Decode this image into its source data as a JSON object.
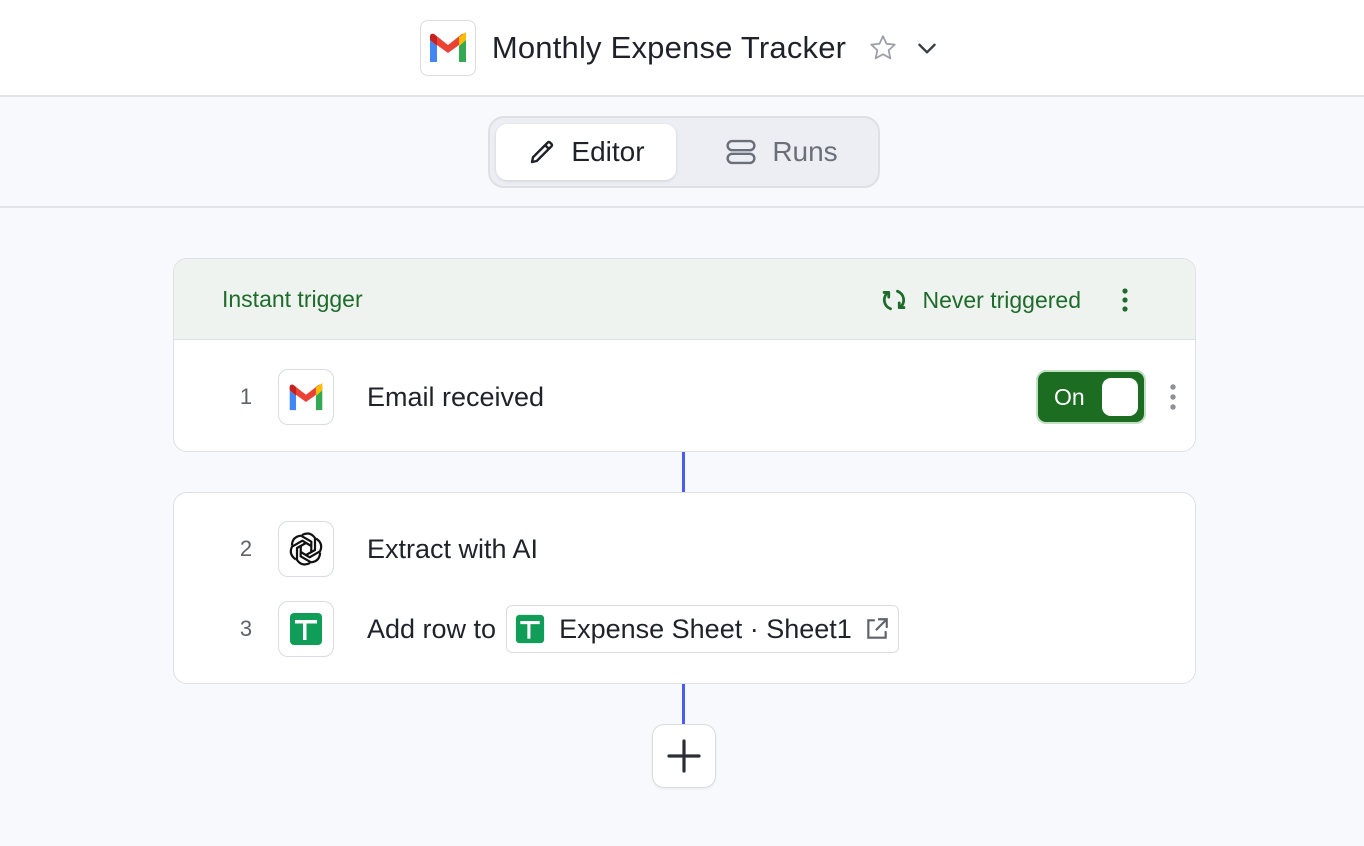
{
  "header": {
    "title": "Monthly Expense Tracker",
    "app_icon": "gmail-icon",
    "star_icon": "star-icon",
    "dropdown_icon": "chevron-down-icon"
  },
  "tabs": [
    {
      "label": "Editor",
      "icon": "pencil-icon",
      "active": true
    },
    {
      "label": "Runs",
      "icon": "runs-icon",
      "active": false
    }
  ],
  "trigger_card": {
    "label": "Instant trigger",
    "status": "Never triggered",
    "status_icon": "refresh-icon",
    "steps": [
      {
        "number": "1",
        "icon": "gmail-icon",
        "label": "Email received",
        "toggle_label": "On",
        "toggle_on": true
      }
    ]
  },
  "action_card": {
    "steps": [
      {
        "number": "2",
        "icon": "openai-icon",
        "label": "Extract with AI"
      },
      {
        "number": "3",
        "icon": "google-sheets-icon",
        "label": "Add row to",
        "target": "Expense Sheet · Sheet1",
        "target_icon": "external-link-icon"
      }
    ]
  },
  "add_step": {
    "icon": "plus-icon"
  },
  "colors": {
    "accent_green": "#1c6c22",
    "header_green_text": "#1e6b2b",
    "connector_blue": "#4b5cf0",
    "sheets_green": "#0f9d58"
  }
}
